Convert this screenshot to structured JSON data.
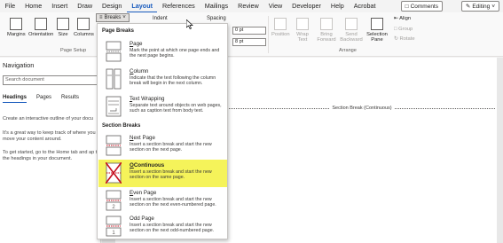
{
  "menu": {
    "tabs": [
      "File",
      "Home",
      "Insert",
      "Draw",
      "Design",
      "Layout",
      "References",
      "Mailings",
      "Review",
      "View",
      "Developer",
      "Help",
      "Acrobat"
    ],
    "active_tab": "Layout",
    "comments_label": "Comments",
    "editing_label": "Editing"
  },
  "ribbon": {
    "page_setup": {
      "buttons": [
        "Margins",
        "Orientation",
        "Size",
        "Columns"
      ],
      "group_label": "Page Setup"
    },
    "breaks_label": "Breaks",
    "indent_label": "Indent",
    "spacing_label": "Spacing",
    "spacing_before": "0 pt",
    "spacing_after": "8 pt",
    "arrange": {
      "buttons": [
        "Position",
        "Wrap Text",
        "Bring Forward",
        "Send Backward",
        "Selection Pane"
      ],
      "align_label": "Align",
      "group_label_small": "Group",
      "rotate_label": "Rotate",
      "group_label": "Arrange"
    }
  },
  "navigation": {
    "title": "Navigation",
    "search_placeholder": "Search document",
    "tabs": [
      "Headings",
      "Pages",
      "Results"
    ],
    "active_tab": "Headings",
    "text1": "Create an interactive outline of your docu",
    "text2": "It's a great way to keep track of where you move your content around.",
    "text3": "To get started, go to the Home tab and ap to the headings in your document."
  },
  "document": {
    "section_break_label": "Section Break (Continuous)"
  },
  "breaks_menu": {
    "page_breaks_header": "Page Breaks",
    "section_breaks_header": "Section Breaks",
    "page_items": [
      {
        "title": "Page",
        "accel": "P",
        "rest": "age",
        "desc": "Mark the point at which one page ends and the next page begins."
      },
      {
        "title": "Column",
        "accel": "C",
        "rest": "olumn",
        "desc": "Indicate that the text following the column break will begin in the next column."
      },
      {
        "title": "Text Wrapping",
        "accel": "T",
        "rest": "ext Wrapping",
        "desc": "Separate text around objects on web pages, such as caption text from body text."
      }
    ],
    "section_items": [
      {
        "title": "Next Page",
        "accel": "N",
        "rest": "ext Page",
        "desc": "Insert a section break and start the new section on the next page."
      },
      {
        "title": "Continuous",
        "accel": "O",
        "rest": "Continuous",
        "desc": "Insert a section break and start the new section on the same page."
      },
      {
        "title": "Even Page",
        "accel": "E",
        "rest": "ven Page",
        "desc": "Insert a section break and start the new section on the next even-numbered page."
      },
      {
        "title": "Odd Page",
        "accel": "D",
        "rest": "Odd Page",
        "desc": "Insert a section break and start the new section on the next odd-numbered page."
      }
    ],
    "highlight_color": "#f5f35a",
    "icons": [
      "page-break-icon",
      "column-break-icon",
      "text-wrapping-break-icon",
      "next-page-break-icon",
      "continuous-break-icon",
      "even-page-break-icon",
      "odd-page-break-icon"
    ]
  }
}
